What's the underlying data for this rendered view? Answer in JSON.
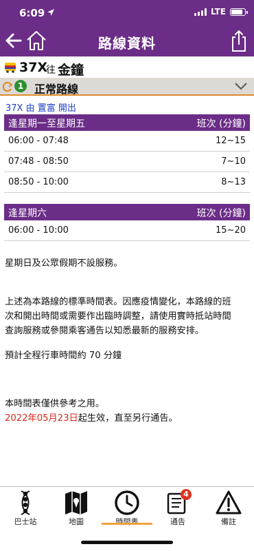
{
  "status_bar": {
    "time": "6:09",
    "network": "LTE",
    "battery_level": 0.85
  },
  "nav": {
    "title": "路線資料"
  },
  "route": {
    "number": "37X",
    "direction_prefix": "往",
    "destination": "金鐘"
  },
  "variant": {
    "badge": "1",
    "name": "正常路線"
  },
  "origin_text": "37X 由 置富 開出",
  "weekday_table": {
    "header_left": "逢星期一至星期五",
    "header_right": "班次 (分鐘)",
    "rows": [
      {
        "time": "06:00 - 07:48",
        "freq": "12~15"
      },
      {
        "time": "07:48 - 08:50",
        "freq": "7~10"
      },
      {
        "time": "08:50 - 10:00",
        "freq": "8~13"
      }
    ]
  },
  "saturday_table": {
    "header_left": "逢星期六",
    "header_right": "班次 (分鐘)",
    "rows": [
      {
        "time": "06:00 - 10:00",
        "freq": "15~20"
      }
    ]
  },
  "notes": {
    "holiday": "星期日及公眾假期不設服務。",
    "disclaimer_lines": [
      "上述為本路線的標準時間表。因應疫情變化，本路線的班",
      "次和開出時間或需要作出臨時調整，請使用實時抵站時間",
      "查詢服務或參閱乘客通告以知悉最新的服務安排。"
    ],
    "journey_time": "預計全程行車時間約 70 分鐘",
    "reference_only": "本時間表僅供參考之用。",
    "effective_date": "2022年05月23日",
    "effective_suffix": "起生效，直至另行通告。"
  },
  "tabs": [
    {
      "label": "巴士站",
      "icon": "bus-stop-icon"
    },
    {
      "label": "地圖",
      "icon": "map-icon"
    },
    {
      "label": "時間表",
      "icon": "clock-icon",
      "active": true
    },
    {
      "label": "通告",
      "icon": "notice-icon",
      "badge": "4"
    },
    {
      "label": "備註",
      "icon": "warning-icon"
    }
  ],
  "colors": {
    "brand_purple": "#6b2d87",
    "accent_orange": "#e08a2c",
    "link_blue": "#1f3ec9",
    "highlight_red": "#d62b1e"
  }
}
